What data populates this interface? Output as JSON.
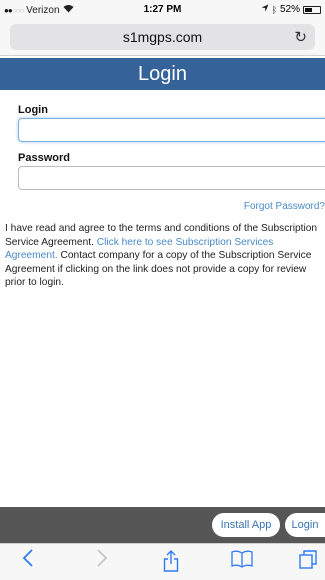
{
  "status_bar": {
    "carrier": "Verizon",
    "time": "1:27 PM",
    "battery": "52%",
    "battery_level": 0.52
  },
  "browser": {
    "url": "s1mgps.com"
  },
  "page": {
    "title": "Login",
    "login_label": "Login",
    "login_value": "",
    "password_label": "Password",
    "password_value": "",
    "forgot_link": "Forgot Password?",
    "terms_text_1": "I have read and agree to the terms and conditions of the Subscription Service Agreement. ",
    "terms_link": "Click here to see Subscription Services Agreement.",
    "terms_text_2": " Contact company for a copy of the Subscription Service Agreement if clicking on the link does not provide a copy for review prior to login."
  },
  "app_bar": {
    "install_label": "Install App",
    "login_label": "Login"
  },
  "icons": {
    "back": "chevron-left-icon",
    "forward": "chevron-right-icon",
    "share": "share-icon",
    "bookmarks": "book-icon",
    "tabs": "tabs-icon",
    "reload": "reload-icon"
  },
  "colors": {
    "header": "#36629a",
    "link": "#4a8ac8",
    "app_bar": "#565656",
    "ios_blue": "#2f7cf6"
  }
}
